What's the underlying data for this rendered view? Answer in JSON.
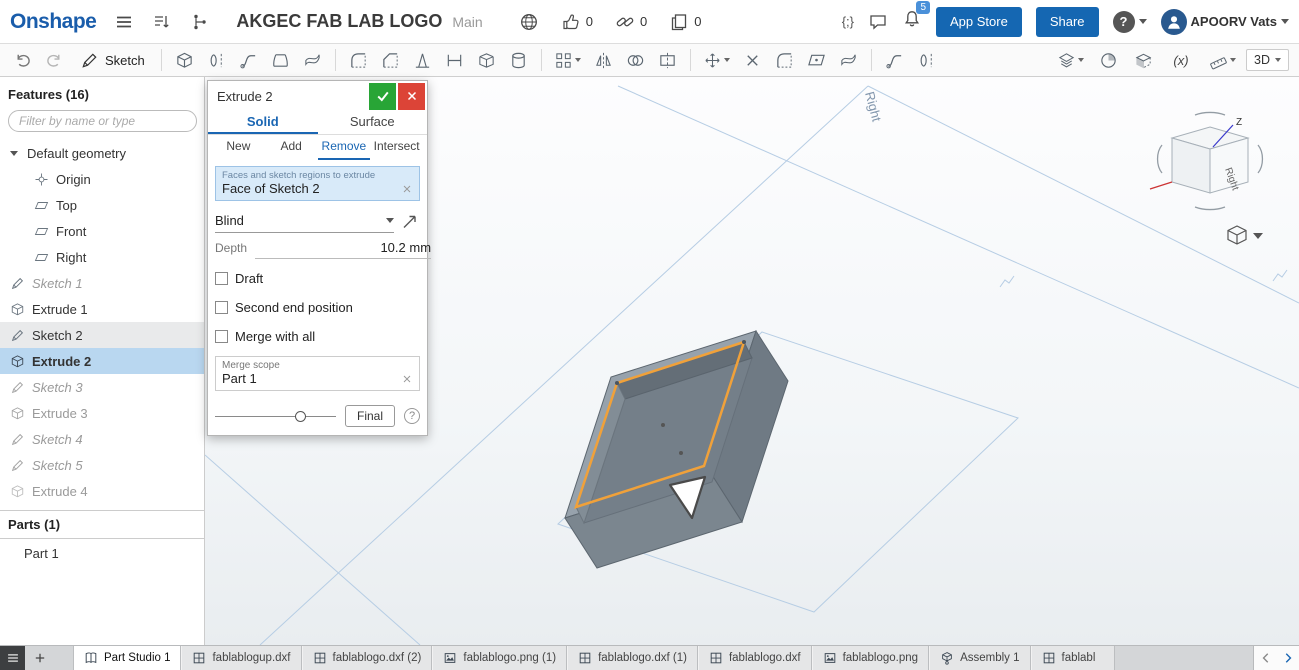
{
  "colors": {
    "accent_blue": "#1a66b3",
    "selection_bg": "#b9d7f0",
    "confirm_green": "#28a536",
    "cancel_red": "#dc4437",
    "sketch_orange": "#f0a13a"
  },
  "header": {
    "logo": "Onshape",
    "doc_title": "AKGEC FAB LAB LOGO",
    "workspace": "Main",
    "like_count": "0",
    "link_count": "0",
    "fork_count": "0",
    "fs_glyph": "{;}",
    "notification_count": "5",
    "app_store_label": "App Store",
    "share_label": "Share",
    "help_glyph": "?",
    "user_name": "APOORV Vats"
  },
  "toolbar": {
    "sketch_label": "Sketch",
    "variables_label": "(x)",
    "view_mode_label": "3D"
  },
  "features_panel": {
    "title": "Features (16)",
    "filter_placeholder": "Filter by name or type",
    "tree": [
      {
        "label": "Default geometry"
      },
      {
        "label": "Origin"
      },
      {
        "label": "Top"
      },
      {
        "label": "Front"
      },
      {
        "label": "Right"
      },
      {
        "label": "Sketch 1",
        "state": "suppressed"
      },
      {
        "label": "Extrude 1"
      },
      {
        "label": "Sketch 2",
        "state": "highlighted"
      },
      {
        "label": "Extrude 2",
        "state": "selected"
      },
      {
        "label": "Sketch 3",
        "state": "suppressed"
      },
      {
        "label": "Extrude 3",
        "state": "suppressed"
      },
      {
        "label": "Sketch 4",
        "state": "suppressed"
      },
      {
        "label": "Sketch 5",
        "state": "suppressed"
      },
      {
        "label": "Extrude 4",
        "state": "suppressed"
      }
    ],
    "parts_title": "Parts (1)",
    "parts": [
      {
        "label": "Part 1"
      }
    ]
  },
  "dialog": {
    "title": "Extrude 2",
    "tabs": [
      "Solid",
      "Surface"
    ],
    "active_tab": "Solid",
    "modes": [
      "New",
      "Add",
      "Remove",
      "Intersect"
    ],
    "active_mode": "Remove",
    "selection_label": "Faces and sketch regions to extrude",
    "selection_value": "Face of Sketch 2",
    "end_condition": "Blind",
    "depth_label": "Depth",
    "depth_value": "10.2 mm",
    "checkboxes": [
      "Draft",
      "Second end position",
      "Merge with all"
    ],
    "merge_scope_label": "Merge scope",
    "merge_scope_value": "Part 1",
    "final_button": "Final",
    "help_glyph": "?"
  },
  "viewport": {
    "plane_label": "Right",
    "cube_face_label": "Right",
    "z_axis_label": "Z"
  },
  "tabs_bar": {
    "tabs": [
      {
        "label": "Part Studio 1",
        "type": "partstudio",
        "active": true
      },
      {
        "label": "fablablogup.dxf",
        "type": "dxf"
      },
      {
        "label": "fablablogo.dxf (2)",
        "type": "dxf"
      },
      {
        "label": "fablablogo.png (1)",
        "type": "png"
      },
      {
        "label": "fablablogo.dxf (1)",
        "type": "dxf"
      },
      {
        "label": "fablablogo.dxf",
        "type": "dxf"
      },
      {
        "label": "fablablogo.png",
        "type": "png"
      },
      {
        "label": "Assembly 1",
        "type": "assembly"
      },
      {
        "label": "fablabl",
        "type": "dxf"
      }
    ]
  }
}
